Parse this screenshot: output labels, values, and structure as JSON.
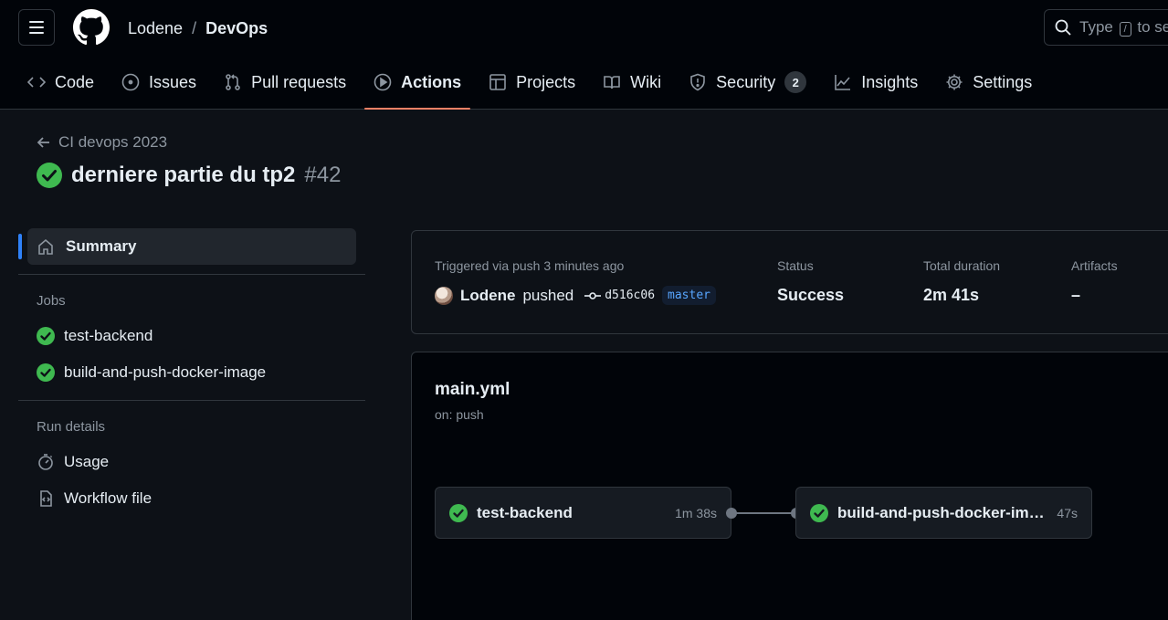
{
  "header": {
    "owner": "Lodene",
    "separator": "/",
    "repo": "DevOps",
    "search_placeholder_start": "Type",
    "search_key": "/",
    "search_placeholder_end": "to se"
  },
  "tabs": [
    {
      "label": "Code",
      "icon": "code-icon"
    },
    {
      "label": "Issues",
      "icon": "issue-icon"
    },
    {
      "label": "Pull requests",
      "icon": "pull-request-icon"
    },
    {
      "label": "Actions",
      "icon": "play-icon",
      "active": true
    },
    {
      "label": "Projects",
      "icon": "table-icon"
    },
    {
      "label": "Wiki",
      "icon": "book-icon"
    },
    {
      "label": "Security",
      "icon": "shield-icon",
      "counter": "2"
    },
    {
      "label": "Insights",
      "icon": "graph-icon"
    },
    {
      "label": "Settings",
      "icon": "gear-icon"
    }
  ],
  "run": {
    "workflow_link": "CI devops 2023",
    "title": "derniere partie du tp2",
    "number": "#42"
  },
  "sidebar": {
    "summary_label": "Summary",
    "jobs_heading": "Jobs",
    "jobs": [
      "test-backend",
      "build-and-push-docker-image"
    ],
    "run_details_heading": "Run details",
    "usage_label": "Usage",
    "workflow_file_label": "Workflow file"
  },
  "summary_card": {
    "trigger_label": "Triggered via push 3 minutes ago",
    "actor": "Lodene",
    "action": "pushed",
    "commit": "d516c06",
    "branch": "master",
    "status_label": "Status",
    "status_value": "Success",
    "duration_label": "Total duration",
    "duration_value": "2m 41s",
    "artifacts_label": "Artifacts",
    "artifacts_value": "–"
  },
  "workflow": {
    "file": "main.yml",
    "trigger": "on: push",
    "jobs": [
      {
        "name": "test-backend",
        "duration": "1m 38s"
      },
      {
        "name": "build-and-push-docker-image",
        "duration": "47s"
      }
    ]
  },
  "colors": {
    "background": "#0d1117",
    "header_bg": "#010409",
    "success": "#3fb950",
    "active_tab_underline": "#f78166",
    "accent": "#2f81f7",
    "muted_text": "#8d96a0"
  }
}
